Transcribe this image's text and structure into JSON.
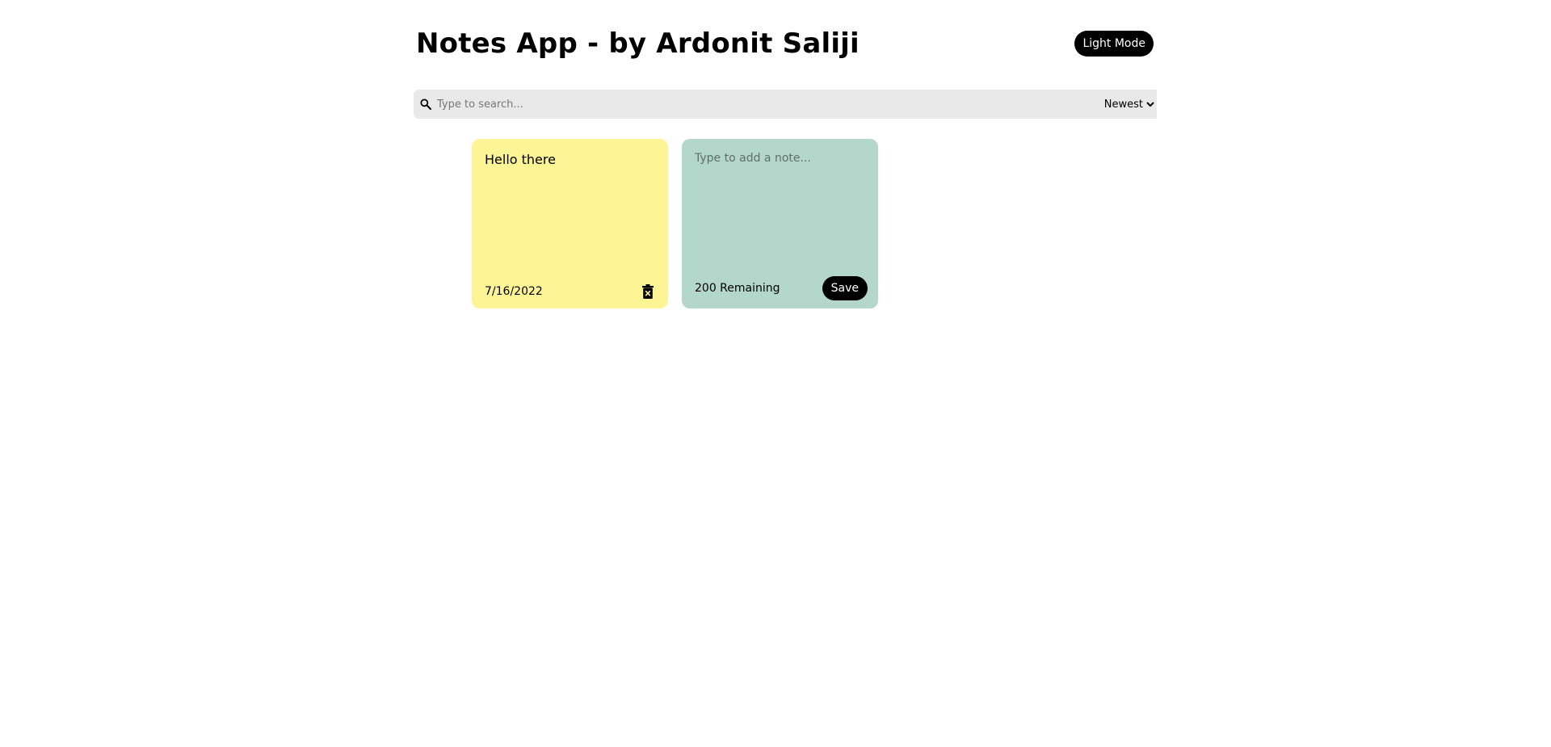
{
  "header": {
    "title": "Notes App - by Ardonit Saliji",
    "mode_button_label": "Light Mode"
  },
  "search": {
    "placeholder": "Type to search...",
    "value": "",
    "icon": "search-icon"
  },
  "sort": {
    "selected": "Newest"
  },
  "notes": [
    {
      "text": "Hello there",
      "date": "7/16/2022",
      "color": "#fdf496",
      "delete_icon": "trash-icon"
    }
  ],
  "add_note": {
    "placeholder": "Type to add a note...",
    "value": "",
    "remaining_text": "200 Remaining",
    "save_label": "Save",
    "color": "#b4d7cb"
  }
}
